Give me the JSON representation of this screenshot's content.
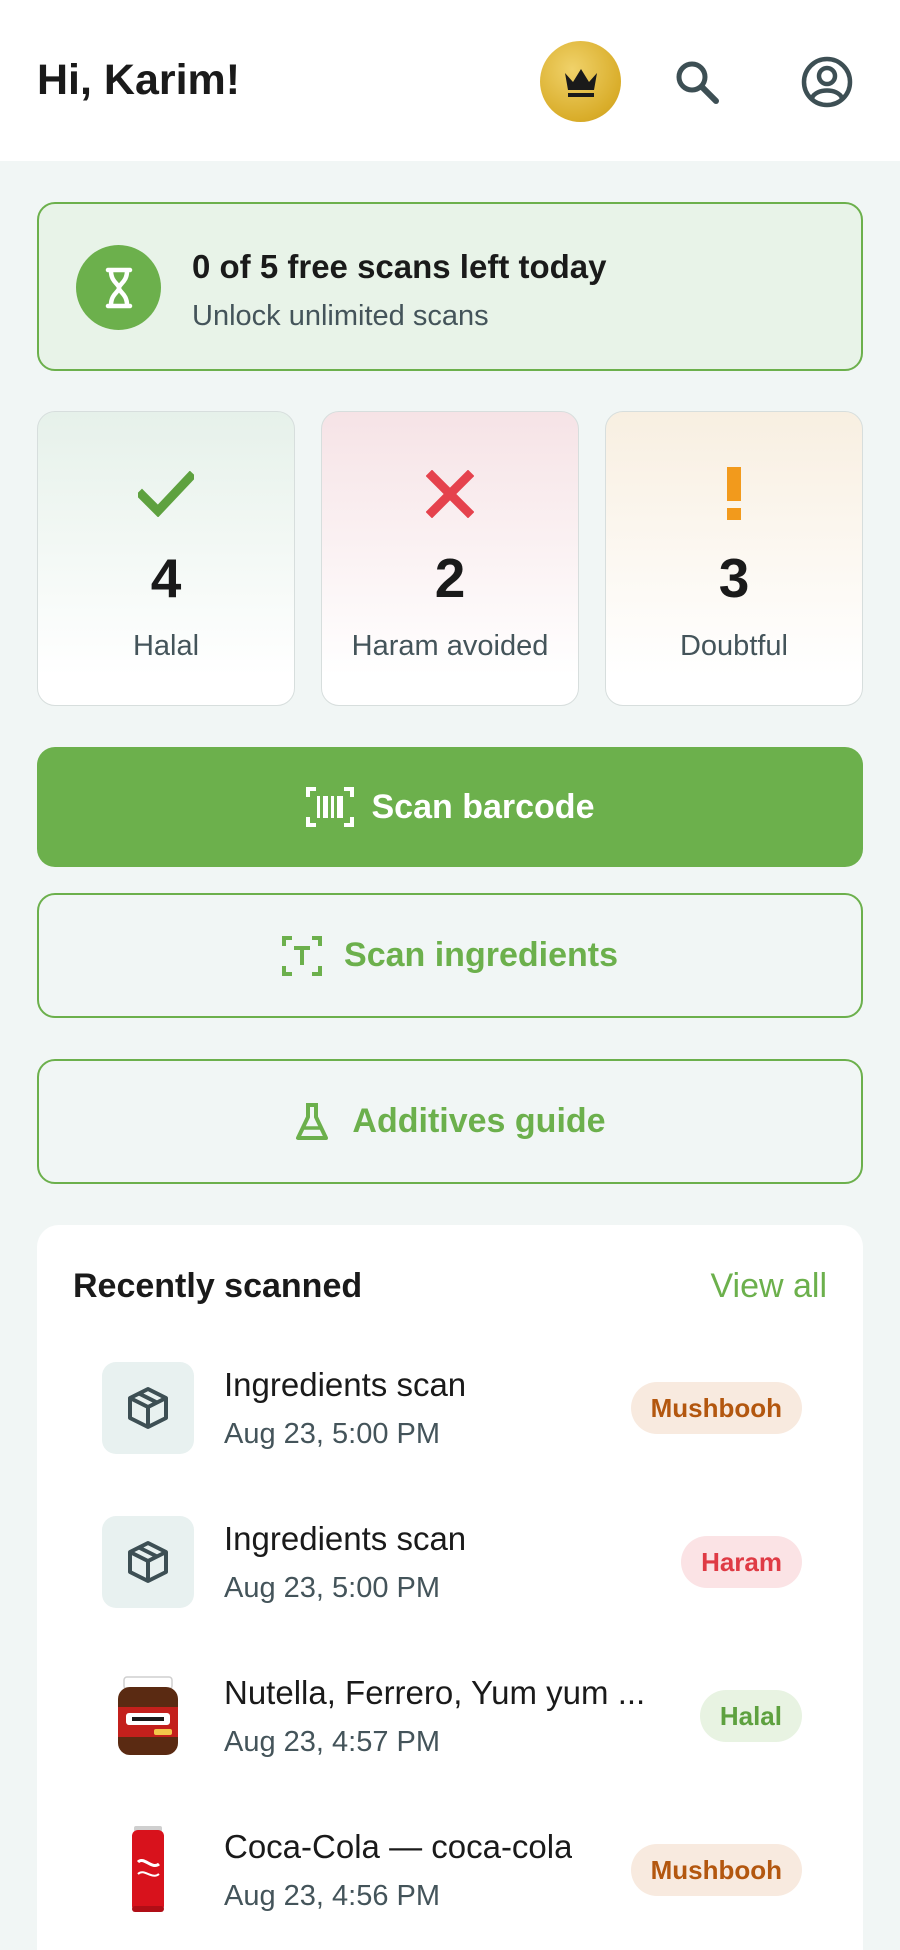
{
  "header": {
    "greeting": "Hi, Karim!",
    "premium_icon": "crown-icon",
    "search_icon": "search-icon",
    "account_icon": "account-circle-icon"
  },
  "quota": {
    "title": "0 of 5 free scans left today",
    "subtitle": "Unlock unlimited scans",
    "icon": "hourglass-icon"
  },
  "stats": [
    {
      "value": "4",
      "label": "Halal",
      "icon": "check-icon",
      "color": "#5ea13f"
    },
    {
      "value": "2",
      "label": "Haram avoided",
      "icon": "x-icon",
      "color": "#e5424d"
    },
    {
      "value": "3",
      "label": "Doubtful",
      "icon": "exclamation-icon",
      "color": "#f29a1c"
    }
  ],
  "actions": {
    "scan_barcode": "Scan barcode",
    "scan_ingredients": "Scan ingredients",
    "additives_guide": "Additives guide"
  },
  "recent": {
    "title": "Recently scanned",
    "view_all": "View all",
    "items": [
      {
        "title": "Ingredients scan",
        "date": "Aug 23, 5:00 PM",
        "status": "Mushbooh",
        "thumb": "package-icon"
      },
      {
        "title": "Ingredients scan",
        "date": "Aug 23, 5:00 PM",
        "status": "Haram",
        "thumb": "package-icon"
      },
      {
        "title": "Nutella, Ferrero, Yum yum ...",
        "date": "Aug 23, 4:57 PM",
        "status": "Halal",
        "thumb": "nutella-jar-image"
      },
      {
        "title": "Coca-Cola — coca-cola",
        "date": "Aug 23, 4:56 PM",
        "status": "Mushbooh",
        "thumb": "coca-cola-can-image"
      }
    ]
  },
  "colors": {
    "brand_green": "#6cb04c",
    "haram_red": "#e5424d",
    "doubt_orange": "#f29a1c",
    "crown_gold": "#d9ad2a"
  }
}
